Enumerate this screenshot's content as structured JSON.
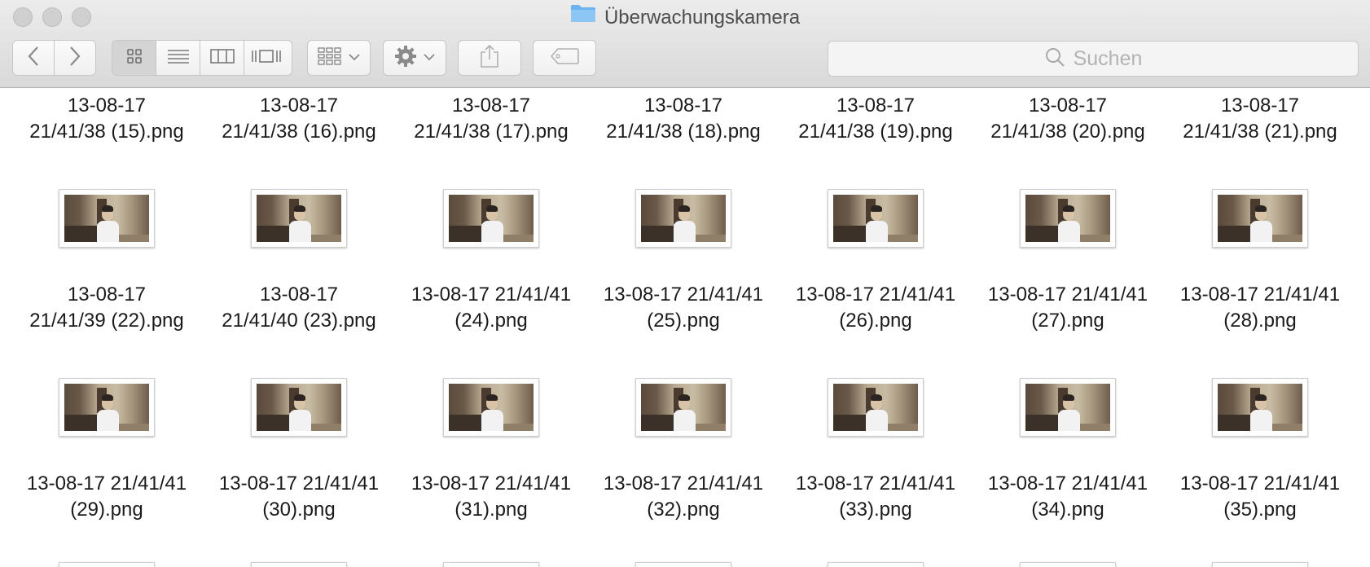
{
  "window": {
    "title": "Überwachungskamera",
    "accent_folder_color": "#6cb3f0"
  },
  "toolbar": {
    "back_icon": "chevron-left-icon",
    "forward_icon": "chevron-right-icon",
    "view_modes": [
      "icon-view-icon",
      "list-view-icon",
      "column-view-icon",
      "cover-flow-icon"
    ],
    "active_view": "icon-view-icon",
    "arrange_icon": "arrange-grid-icon",
    "action_icon": "gear-icon",
    "share_icon": "share-icon",
    "tag_icon": "tag-icon"
  },
  "search": {
    "placeholder": "Suchen",
    "icon": "search-icon"
  },
  "files": {
    "row1": [
      {
        "line1": "13-08-17",
        "line2": "21/41/38 (15).png"
      },
      {
        "line1": "13-08-17",
        "line2": "21/41/38 (16).png"
      },
      {
        "line1": "13-08-17",
        "line2": "21/41/38 (17).png"
      },
      {
        "line1": "13-08-17",
        "line2": "21/41/38 (18).png"
      },
      {
        "line1": "13-08-17",
        "line2": "21/41/38 (19).png"
      },
      {
        "line1": "13-08-17",
        "line2": "21/41/38 (20).png"
      },
      {
        "line1": "13-08-17",
        "line2": "21/41/38 (21).png"
      }
    ],
    "row2": [
      {
        "line1": "13-08-17",
        "line2": "21/41/39 (22).png"
      },
      {
        "line1": "13-08-17",
        "line2": "21/41/40 (23).png"
      },
      {
        "line1": "13-08-17 21/41/41",
        "line2": "(24).png"
      },
      {
        "line1": "13-08-17 21/41/41",
        "line2": "(25).png"
      },
      {
        "line1": "13-08-17 21/41/41",
        "line2": "(26).png"
      },
      {
        "line1": "13-08-17 21/41/41",
        "line2": "(27).png"
      },
      {
        "line1": "13-08-17 21/41/41",
        "line2": "(28).png"
      }
    ],
    "row3": [
      {
        "line1": "13-08-17 21/41/41",
        "line2": "(29).png"
      },
      {
        "line1": "13-08-17 21/41/41",
        "line2": "(30).png"
      },
      {
        "line1": "13-08-17 21/41/41",
        "line2": "(31).png"
      },
      {
        "line1": "13-08-17 21/41/41",
        "line2": "(32).png"
      },
      {
        "line1": "13-08-17 21/41/41",
        "line2": "(33).png"
      },
      {
        "line1": "13-08-17 21/41/41",
        "line2": "(34).png"
      },
      {
        "line1": "13-08-17 21/41/41",
        "line2": "(35).png"
      }
    ]
  }
}
